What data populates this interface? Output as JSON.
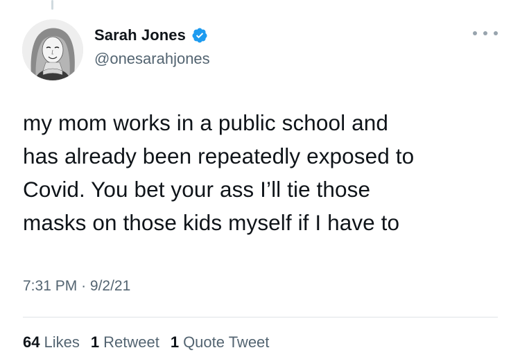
{
  "tweet": {
    "author": {
      "display_name": "Sarah Jones",
      "handle": "@onesarahjones",
      "verified": true,
      "avatar_icon": "profile-photo"
    },
    "text_lines": [
      "my mom works in a public school and",
      "has already been repeatedly exposed to",
      "Covid. You bet your ass I’ll tie those",
      "masks on those kids myself if I have to"
    ],
    "time": "7:31 PM",
    "separator": "·",
    "date": "9/2/21",
    "stats": {
      "likes": {
        "count": "64",
        "label": "Likes"
      },
      "retweets": {
        "count": "1",
        "label": "Retweet"
      },
      "quote_tweets": {
        "count": "1",
        "label": "Quote Tweet"
      }
    }
  },
  "colors": {
    "verified_badge": "#1d9bf0",
    "secondary_text": "#536471",
    "primary_text": "#0f1419"
  },
  "icons": {
    "more": "more-options-icon",
    "verified": "verified-badge-icon"
  }
}
